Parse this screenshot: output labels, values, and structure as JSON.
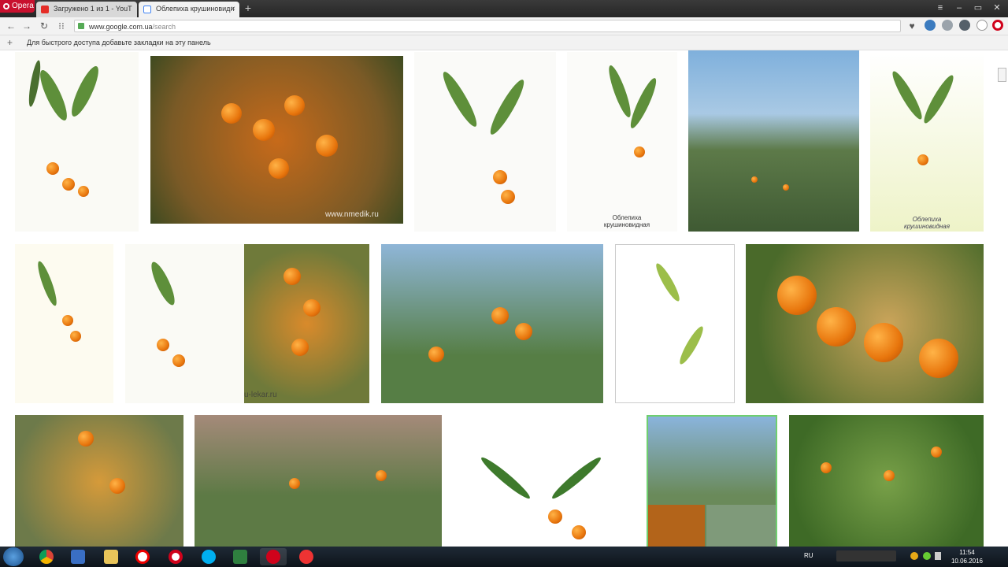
{
  "browser": {
    "app_button_label": "Opera",
    "tabs": [
      {
        "title": "Загружено 1 из 1 - YouT",
        "icon": "youtube-icon",
        "active": false
      },
      {
        "title": "Облепиха крушиновидн",
        "icon": "google-icon",
        "active": true
      }
    ],
    "url_host": "www.google.com.ua",
    "url_path": "/search",
    "bookmarks_hint": "Для быстрого доступа добавьте закладки на эту панель"
  },
  "results": {
    "captions": {
      "img4": "Облепиха крушиновидная",
      "img6": "Облепиха крушиновидная"
    },
    "watermarks": {
      "img2": "www.nmedik.ru",
      "img8": "u-lekar.ru"
    }
  },
  "taskbar": {
    "language": "RU",
    "time": "11:54",
    "date": "10.06.2016"
  },
  "colors": {
    "opera_red": "#c8102e",
    "berry_orange": "#e8760d",
    "selected_outline": "#6fcf6f"
  }
}
